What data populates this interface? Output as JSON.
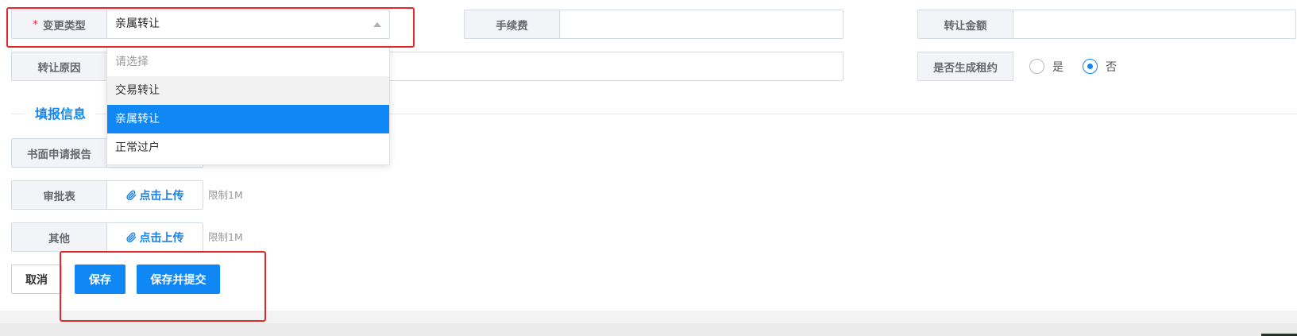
{
  "colors": {
    "accent": "#0f87f5",
    "required_mark": "#f5222d",
    "annotation": "#e5262a",
    "label_bg": "#f2f4f7",
    "hover_bg": "#f2f2f2"
  },
  "icons": {
    "select_caret": "caret-up-icon",
    "upload_button": "paperclip-icon"
  },
  "form": {
    "change_type": {
      "required_mark": "*",
      "label": "变更类型",
      "value": "亲属转让"
    },
    "handling_fee": {
      "label": "手续费"
    },
    "transfer_amount": {
      "label": "转让金额"
    },
    "transfer_reason": {
      "label": "转让原因"
    },
    "generate_lease": {
      "label": "是否生成租约",
      "options": [
        {
          "label": "是",
          "checked": false
        },
        {
          "label": "否",
          "checked": true
        }
      ]
    }
  },
  "change_type_dropdown": {
    "options": [
      {
        "label": "请选择",
        "placeholder": true
      },
      {
        "label": "交易转让",
        "hovered": true
      },
      {
        "label": "亲属转让",
        "selected": true
      },
      {
        "label": "正常过户"
      }
    ]
  },
  "attachments": {
    "title": "填报信息",
    "rows": [
      {
        "label": "书面申请报告"
      },
      {
        "label": "审批表",
        "button": "点击上传",
        "limit": "限制1M"
      },
      {
        "label": "其他",
        "button": "点击上传",
        "limit": "限制1M"
      }
    ]
  },
  "actions": {
    "cancel": "取消",
    "save": "保存",
    "save_submit": "保存并提交"
  }
}
